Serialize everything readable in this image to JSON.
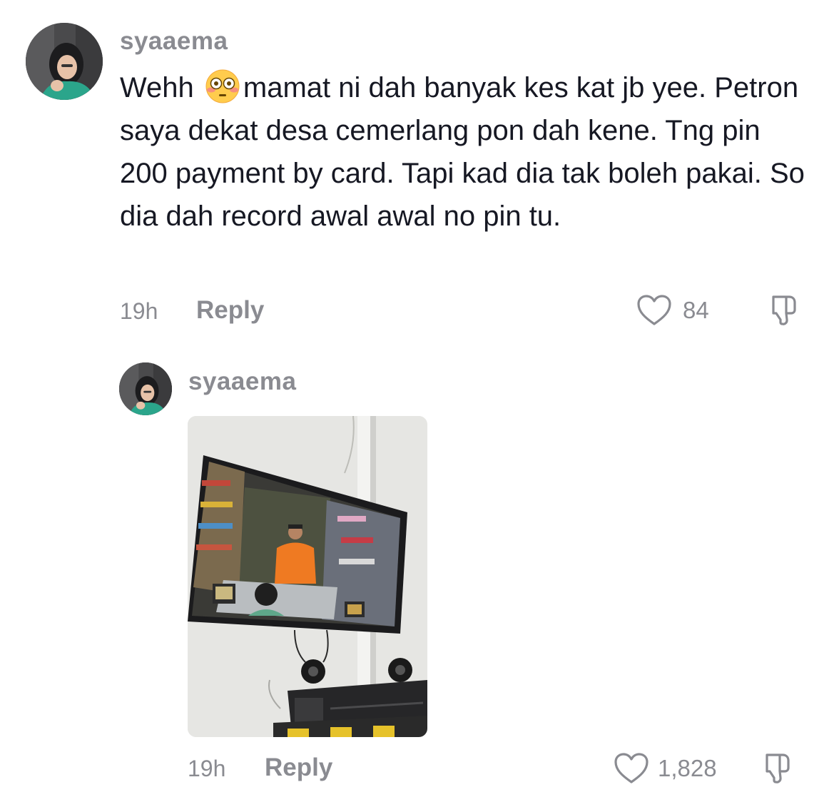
{
  "comments": [
    {
      "username": "syaaema",
      "text_before_emoji": "Wehh ",
      "emoji": "flushed-face-emoji",
      "text_after_emoji": "mamat ni dah banyak kes kat jb yee. Petron saya dekat desa cemerlang pon dah kene. Tng pin 200 payment by card. Tapi kad dia tak boleh pakai. So dia dah record awal awal no pin tu.",
      "time": "19h",
      "reply_label": "Reply",
      "likes": "84"
    },
    {
      "username": "syaaema",
      "image": "photo-cctv-monitor",
      "time": "19h",
      "reply_label": "Reply",
      "likes": "1,828"
    }
  ],
  "icons": {
    "like": "heart-outline-icon",
    "dislike": "thumbs-down-icon"
  },
  "colors": {
    "text_primary": "#161823",
    "text_secondary": "#8a8b91",
    "background": "#ffffff"
  }
}
